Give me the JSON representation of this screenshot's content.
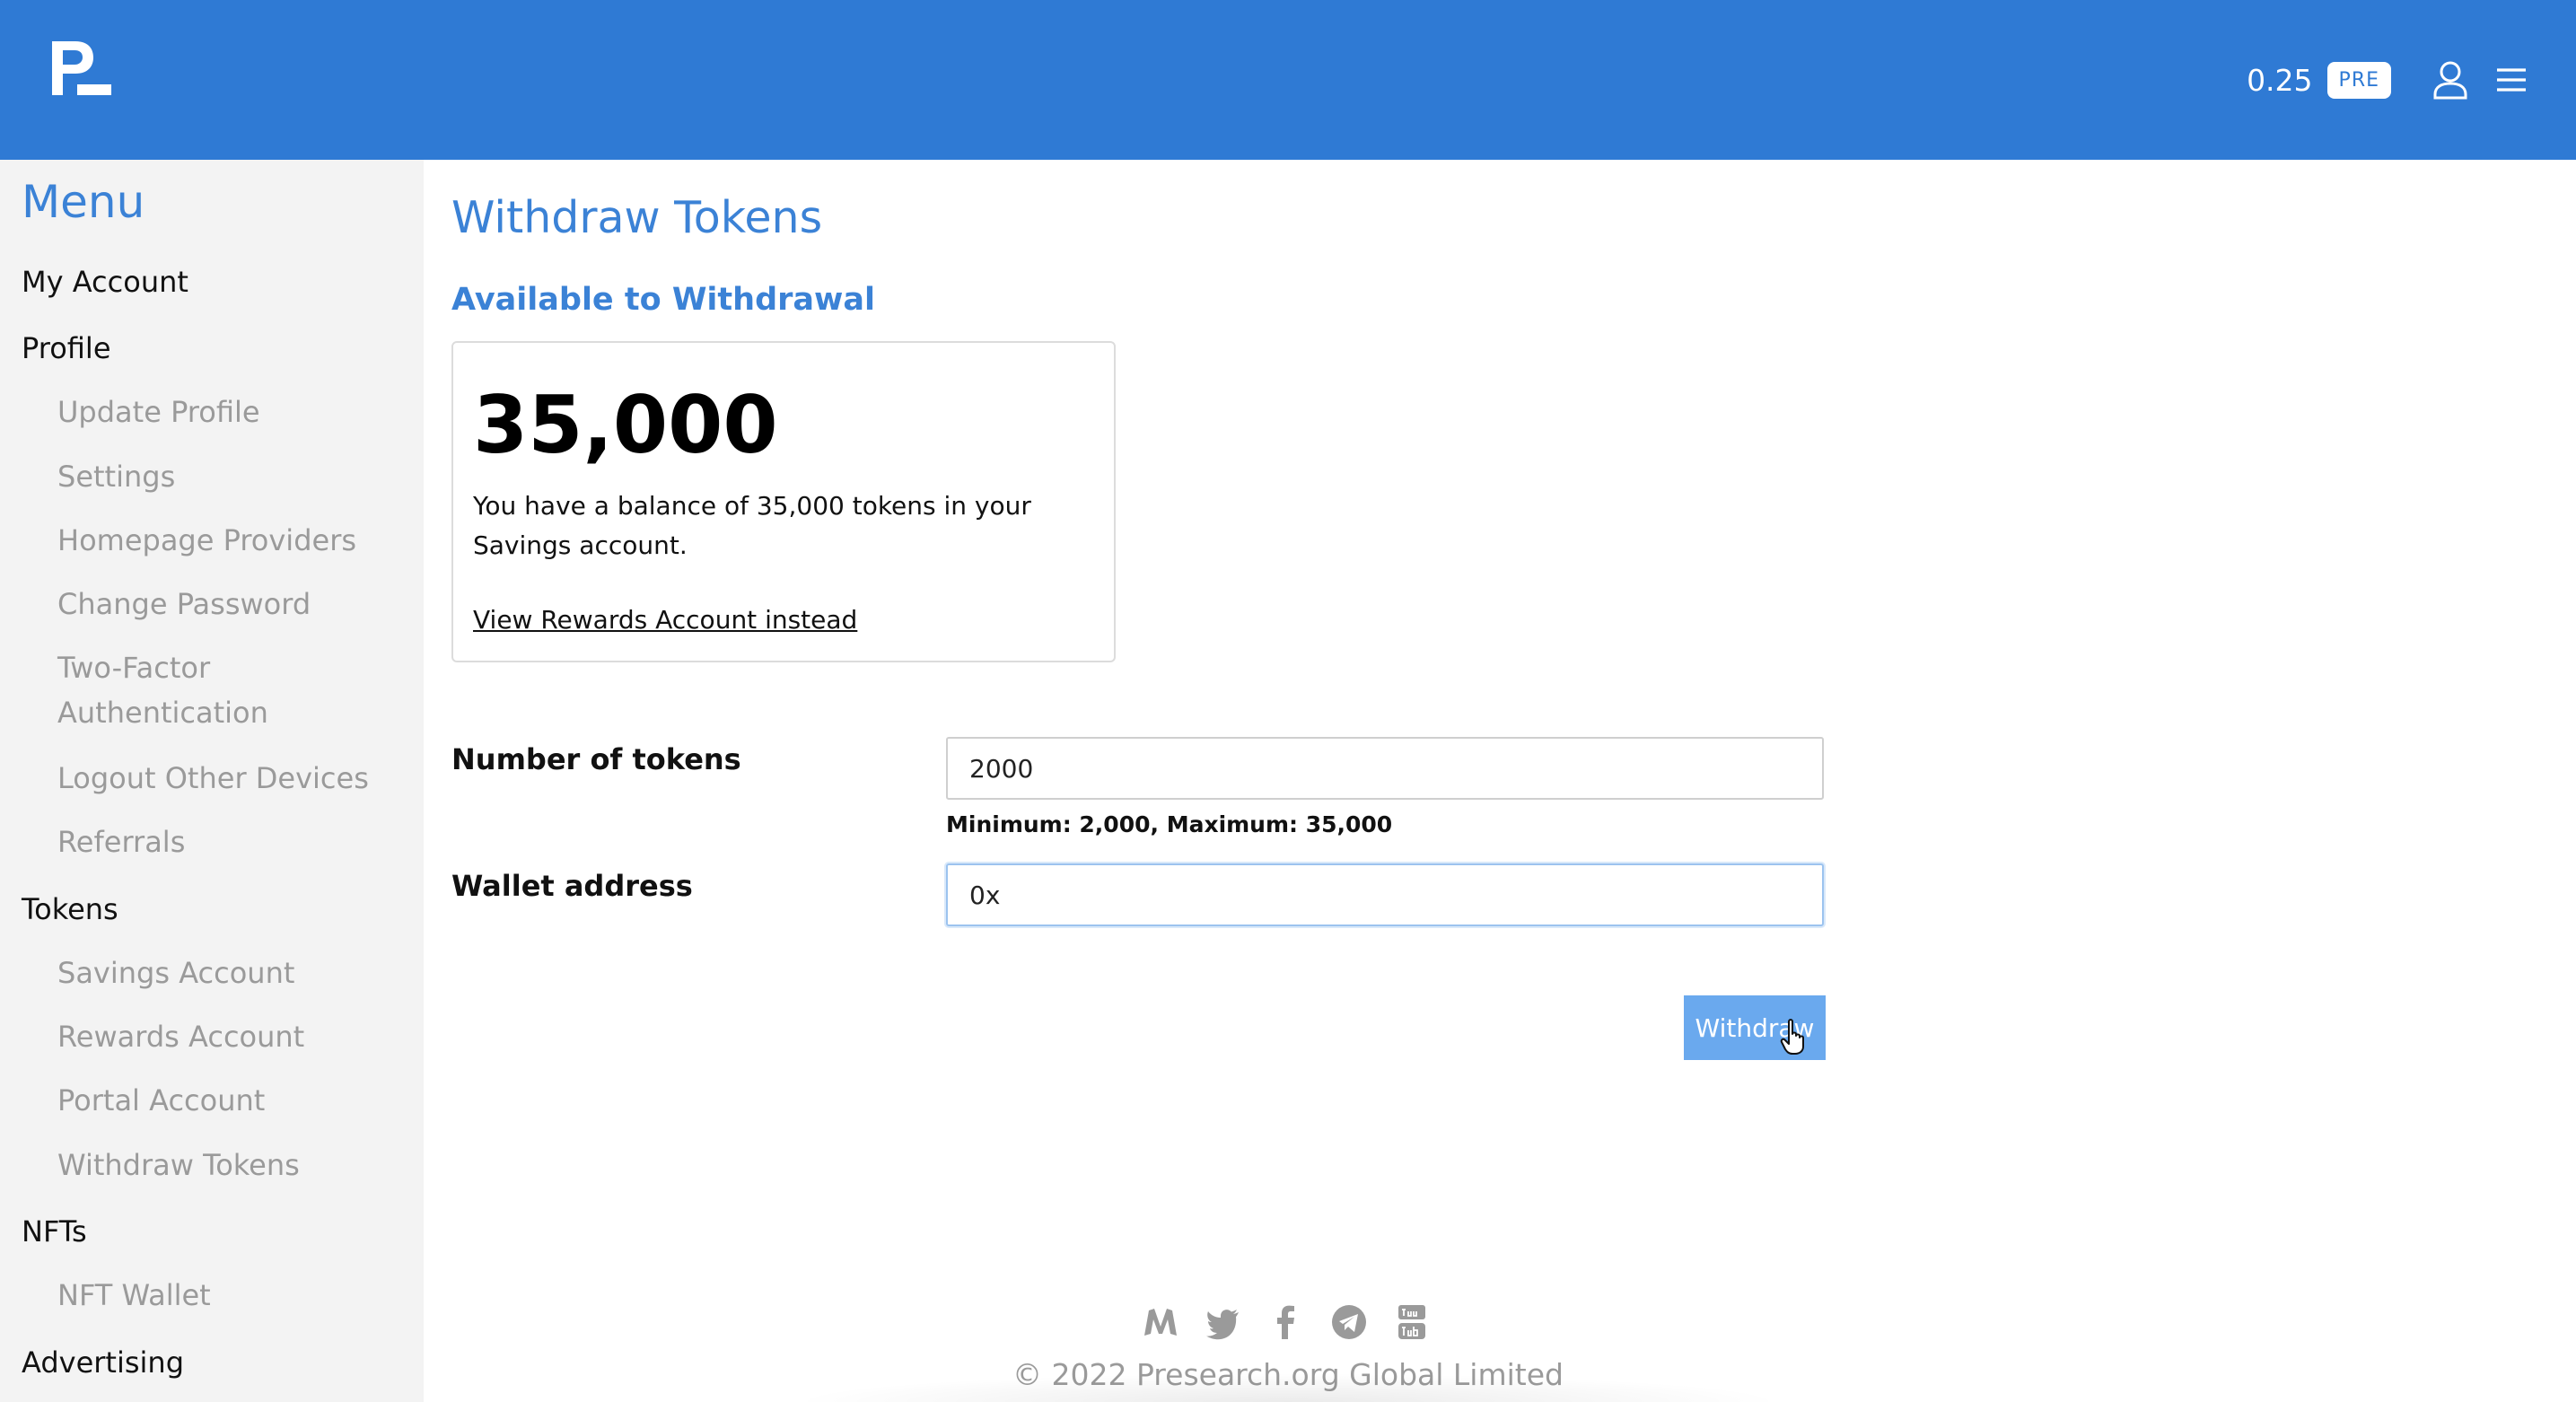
{
  "header": {
    "logo": "presearch-logo",
    "balance": "0.25",
    "currency_badge": "PRE",
    "icons": [
      "user-icon",
      "hamburger-icon"
    ],
    "bg_color": "#2f7ad4"
  },
  "sidebar": {
    "title": "Menu",
    "items": [
      {
        "label": "My Account",
        "level": 1
      },
      {
        "label": "Profile",
        "level": 1
      },
      {
        "label": "Update Profile",
        "level": 2
      },
      {
        "label": "Settings",
        "level": 2
      },
      {
        "label": "Homepage Providers",
        "level": 2
      },
      {
        "label": "Change Password",
        "level": 2
      },
      {
        "label": "Two-Factor Authentication",
        "level": 2
      },
      {
        "label": "Logout Other Devices",
        "level": 2
      },
      {
        "label": "Referrals",
        "level": 2
      },
      {
        "label": "Tokens",
        "level": 1
      },
      {
        "label": "Savings Account",
        "level": 2
      },
      {
        "label": "Rewards Account",
        "level": 2
      },
      {
        "label": "Portal Account",
        "level": 2
      },
      {
        "label": "Withdraw Tokens",
        "level": 2
      },
      {
        "label": "NFTs",
        "level": 1
      },
      {
        "label": "NFT Wallet",
        "level": 2
      },
      {
        "label": "Advertising",
        "level": 1
      }
    ]
  },
  "main": {
    "title": "Withdraw Tokens",
    "section_title": "Available to Withdrawal",
    "card": {
      "amount": "35,000",
      "description": "You have a balance of 35,000 tokens in your Savings account.",
      "link": "View Rewards Account instead"
    },
    "form": {
      "tokens_label": "Number of tokens",
      "tokens_value": "2000",
      "tokens_hint": "Minimum: 2,000, Maximum: 35,000",
      "wallet_label": "Wallet address",
      "wallet_value": "0x",
      "submit_label": "Withdraw"
    }
  },
  "footer": {
    "social_icons": [
      "medium-icon",
      "twitter-icon",
      "facebook-icon",
      "telegram-icon",
      "youtube-icon"
    ],
    "copyright": "© 2022 Presearch.org Global Limited"
  }
}
